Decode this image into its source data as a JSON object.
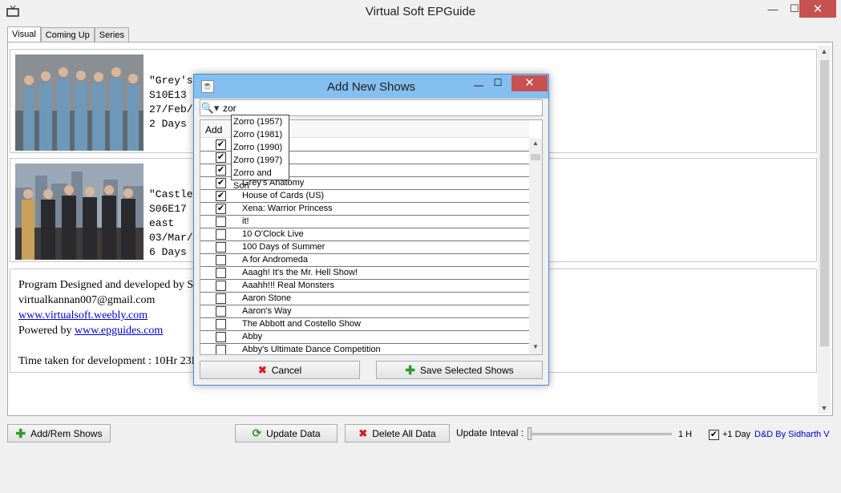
{
  "window": {
    "title": "Virtual Soft EPGuide",
    "min": "—",
    "max": "☐",
    "close": "✕"
  },
  "tabs": [
    "Visual",
    "Coming Up",
    "Series"
  ],
  "cards": [
    {
      "lines": "\"Grey's\nS10E13\n27/Feb/\n2 Days"
    },
    {
      "lines": "\"Castle\nS06E17\neast\n03/Mar/\n6 Days"
    }
  ],
  "info": {
    "line1": "Program Designed and developed by S",
    "email": "virtualkannan007@gmail.com",
    "site": "www.virtualsoft.weebly.com",
    "powered_label": "Powered by ",
    "powered_link": "www.epguides.com",
    "time": "Time taken for development : 10Hr 23M"
  },
  "toolbar": {
    "add_rem": "Add/Rem Shows",
    "update": "Update Data",
    "delete_all": "Delete All Data",
    "update_interval": "Update Inteval :",
    "interval_value": "1 H",
    "plus_day": "+1 Day",
    "credit": "D&D By Sidharth V"
  },
  "dialog": {
    "title": "Add New Shows",
    "search_value": "zor",
    "col_add": "Add",
    "cancel": "Cancel",
    "save": "Save Selected Shows",
    "suggestions": [
      "Zorro (1957)",
      "Zorro (1981)",
      "Zorro (1990)",
      "Zorro (1997)",
      "Zorro and Son"
    ],
    "rows": [
      {
        "name": "",
        "checked": true
      },
      {
        "name": "",
        "checked": true
      },
      {
        "name": "",
        "checked": true
      },
      {
        "name": "Grey's Anatomy",
        "checked": true
      },
      {
        "name": "House of Cards (US)",
        "checked": true
      },
      {
        "name": "Xena: Warrior Princess",
        "checked": true
      },
      {
        "name": "it!",
        "checked": false
      },
      {
        "name": "10 O'Clock Live",
        "checked": false
      },
      {
        "name": "100 Days of Summer",
        "checked": false
      },
      {
        "name": "A for Andromeda",
        "checked": false
      },
      {
        "name": "Aaagh! It's the Mr. Hell Show!",
        "checked": false
      },
      {
        "name": "Aaahh!!! Real Monsters",
        "checked": false
      },
      {
        "name": "Aaron Stone",
        "checked": false
      },
      {
        "name": "Aaron's Way",
        "checked": false
      },
      {
        "name": "The Abbott and Costello Show",
        "checked": false
      },
      {
        "name": "Abby",
        "checked": false
      },
      {
        "name": "Abby's Ultimate Dance Competition",
        "checked": false
      }
    ]
  }
}
